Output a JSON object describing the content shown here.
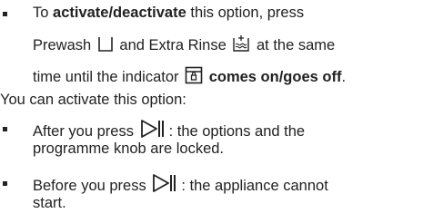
{
  "bullet1": {
    "line1_pre": "To ",
    "line1_bold": "activate/deactivate",
    "line1_post": " this option, press",
    "line2_a": "Prewash",
    "line2_b": "and Extra Rinse",
    "line2_c": "at the same",
    "line3_a": "time until the indicator",
    "line3_bold": "comes on/goes off",
    "line3_end": "."
  },
  "intro": "You can activate this option:",
  "bullet2": {
    "line1_pre": "After you press",
    "line1_post": ": the options and the",
    "line2": "programme knob are locked."
  },
  "bullet3": {
    "line1_pre": "Before you press",
    "line1_post": ": the appliance cannot",
    "line2": "start."
  },
  "icons": [
    "prewash-icon",
    "extra-rinse-icon",
    "child-lock-indicator-icon",
    "start-pause-icon",
    "start-pause-icon"
  ]
}
